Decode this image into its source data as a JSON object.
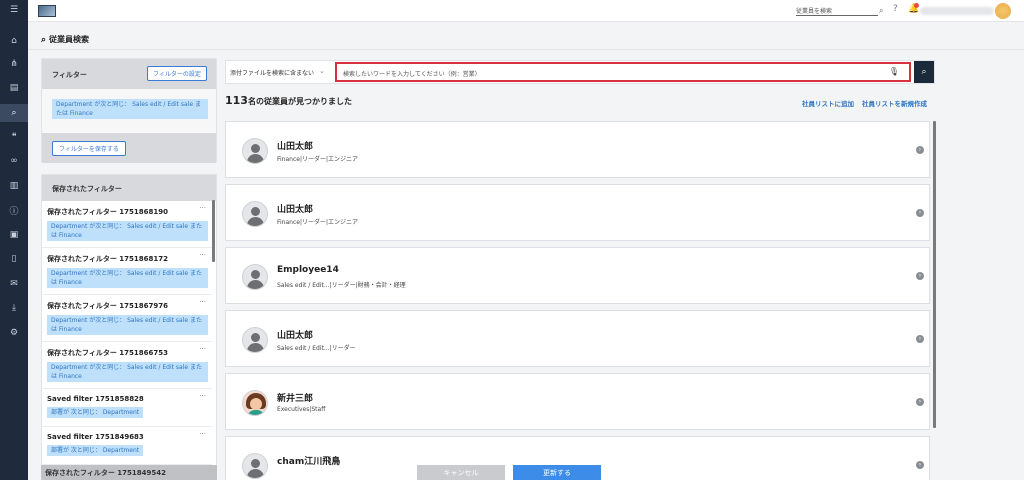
{
  "nav": {
    "items": [
      {
        "icon": "home-icon",
        "glyph": "⌂"
      },
      {
        "icon": "org-chart-icon",
        "glyph": "⋔"
      },
      {
        "icon": "document-icon",
        "glyph": "▤"
      },
      {
        "icon": "search-icon",
        "glyph": "⌕",
        "active": true
      },
      {
        "icon": "chat-icon",
        "glyph": "❝"
      },
      {
        "icon": "link-icon",
        "glyph": "∞"
      },
      {
        "icon": "analytics-icon",
        "glyph": "▥"
      },
      {
        "icon": "info-icon",
        "glyph": "ⓘ"
      },
      {
        "icon": "contact-card-icon",
        "glyph": "▣"
      },
      {
        "icon": "book-icon",
        "glyph": "▯"
      },
      {
        "icon": "mail-icon",
        "glyph": "✉"
      },
      {
        "icon": "download-icon",
        "glyph": "⤓"
      },
      {
        "icon": "user-settings-icon",
        "glyph": "⚙"
      }
    ]
  },
  "topbar": {
    "search_placeholder": "従業員を検索",
    "search_glyph": "⌕",
    "help_glyph": "?",
    "bell_glyph": "🔔"
  },
  "page": {
    "title": "従業員検索",
    "title_glyph": "⌕"
  },
  "filter_panel": {
    "heading": "フィルター",
    "settings_button": "フィルターの設定",
    "active_chip": "Department が次と同じ： Sales edit / Edit sale または Finance",
    "save_button": "フィルターを保存する"
  },
  "saved_filters": {
    "heading": "保存されたフィルター",
    "items": [
      {
        "name": "保存されたフィルター 1751868190",
        "chip": "Department が次と同じ： Sales edit / Edit sale または Finance"
      },
      {
        "name": "保存されたフィルター 1751868172",
        "chip": "Department が次と同じ： Sales edit / Edit sale または Finance"
      },
      {
        "name": "保存されたフィルター 1751867976",
        "chip": "Department が次と同じ： Sales edit / Edit sale または Finance"
      },
      {
        "name": "保存されたフィルター 1751866753",
        "chip": "Department が次と同じ： Sales edit / Edit sale または Finance"
      },
      {
        "name": "Saved filter 1751858828",
        "chip": "部署が 次と同じ： Department"
      },
      {
        "name": "Saved filter 1751849683",
        "chip": "部署が 次と同じ： Department"
      }
    ],
    "more_glyph": "···",
    "footer_partial": "保存されたフィルター 1751849542"
  },
  "search": {
    "attachment_select": "添付ファイルを検索に含まない",
    "chevron": "⌄",
    "placeholder": "検索したいワードを入力してください（例：営業）",
    "mic_glyph": "🎙",
    "button_glyph": "⌕"
  },
  "results_summary": {
    "count": "113",
    "suffix": "名の従業員が見つかりました",
    "add_to_list": "社員リストに追加",
    "create_list": "社員リストを新規作成"
  },
  "results": [
    {
      "name": "山田太郎",
      "sub": "Finance|リーダー|エンジニア",
      "avatar": "default"
    },
    {
      "name": "山田太郎",
      "sub": "Finance|リーダー|エンジニア",
      "avatar": "default"
    },
    {
      "name": "Employee14",
      "sub": "Sales edit / Edit...|リーダー|財務・会計・経理",
      "avatar": "default"
    },
    {
      "name": "山田太郎",
      "sub": "Sales edit / Edit...|リーダー",
      "avatar": "default"
    },
    {
      "name": "新井三郎",
      "sub": "Executives|Staff",
      "avatar": "photo"
    },
    {
      "name": "cham江川飛鳥",
      "sub": "",
      "avatar": "default"
    }
  ],
  "arrow_glyph": "›",
  "actions": {
    "cancel": "キャンセル",
    "update": "更新する"
  }
}
